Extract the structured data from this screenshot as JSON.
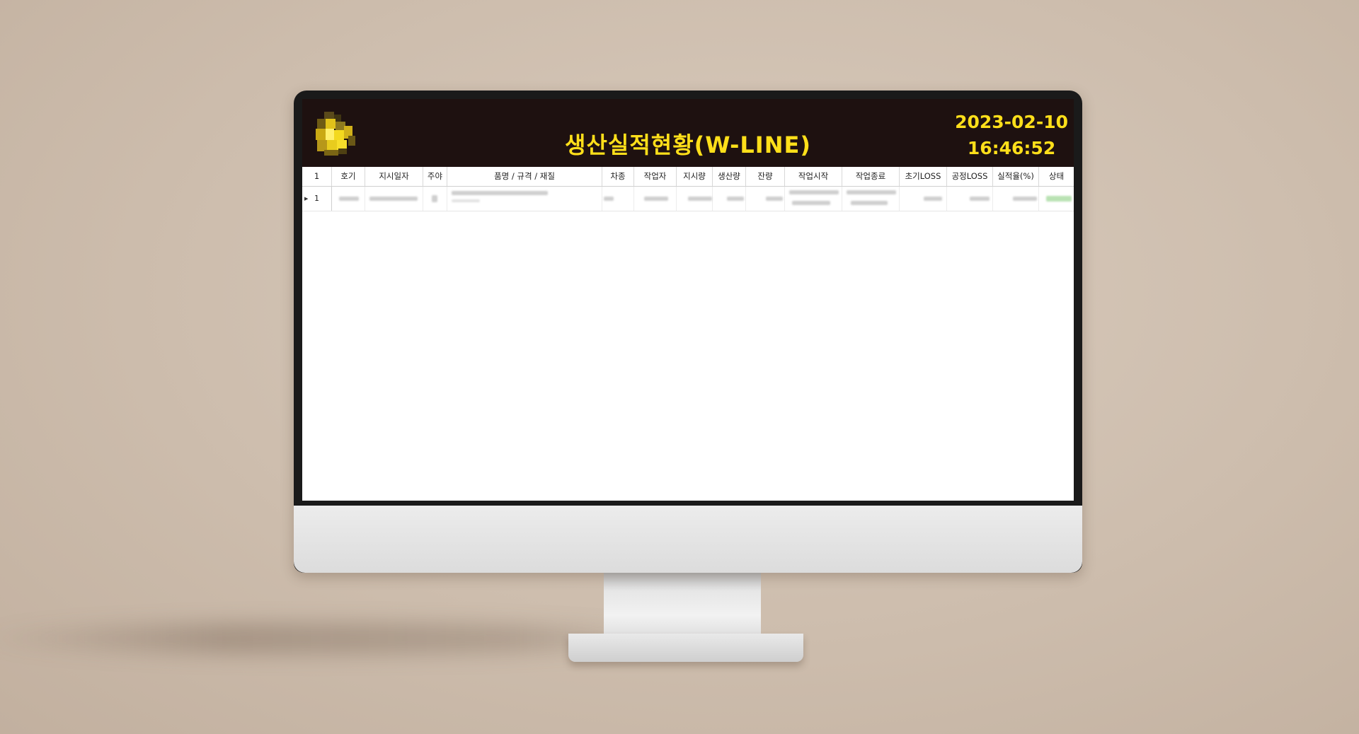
{
  "header": {
    "title": "생산실적현황(W-LINE)",
    "date": "2023-02-10",
    "time": "16:46:52"
  },
  "grid": {
    "corner_label": "1",
    "columns": [
      "호기",
      "지시일자",
      "주야",
      "품명 / 규격 / 재질",
      "차종",
      "작업자",
      "지시량",
      "생산량",
      "잔량",
      "작업시작",
      "작업종료",
      "초기LOSS",
      "공정LOSS",
      "실적율(%)",
      "상태"
    ],
    "rows": [
      {
        "row_number": "1"
      }
    ]
  },
  "colors": {
    "header_background": "#1e1110",
    "header_text": "#ffdf1a"
  }
}
